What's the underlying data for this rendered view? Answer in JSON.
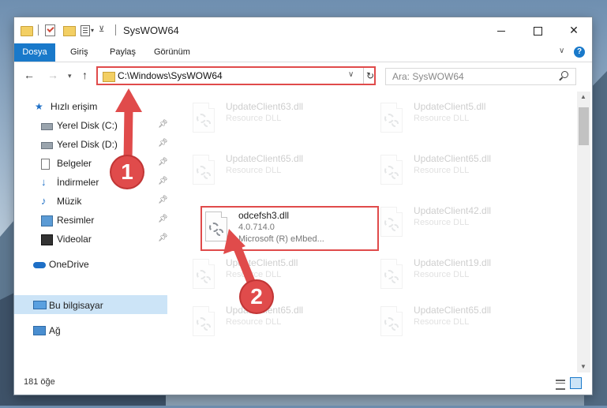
{
  "window": {
    "title": "SysWOW64",
    "controls": {
      "minimize": "",
      "maximize": "",
      "close": "✕"
    }
  },
  "ribbon": {
    "tabs": [
      "Dosya",
      "Giriş",
      "Paylaş",
      "Görünüm"
    ],
    "help": "?"
  },
  "address": {
    "path": "C:\\Windows\\SysWOW64",
    "refresh_icon": "↻",
    "search_placeholder": "Ara: SysWOW64"
  },
  "sidebar": {
    "quick_access": "Hızlı erişim",
    "items": [
      {
        "label": "Yerel Disk (C:)",
        "icon": "disk-icon",
        "pinned": true
      },
      {
        "label": "Yerel Disk (D:)",
        "icon": "disk-icon",
        "pinned": true
      },
      {
        "label": "Belgeler",
        "icon": "documents-icon",
        "pinned": true
      },
      {
        "label": "İndirmeler",
        "icon": "downloads-icon",
        "pinned": true
      },
      {
        "label": "Müzik",
        "icon": "music-icon",
        "pinned": true
      },
      {
        "label": "Resimler",
        "icon": "pictures-icon",
        "pinned": true
      },
      {
        "label": "Videolar",
        "icon": "videos-icon",
        "pinned": true
      }
    ],
    "onedrive": "OneDrive",
    "this_pc": "Bu bilgisayar",
    "network": "Ağ"
  },
  "files": {
    "left": [
      {
        "name": "UpdateClient63.dll",
        "desc": "Resource DLL",
        "faded": true
      },
      {
        "name": "UpdateClient65.dll",
        "desc": "Resource DLL",
        "faded": true
      },
      {
        "name": "odcefsh3.dll",
        "version": "4.0.714.0",
        "desc": "Microsoft (R) eMbed...",
        "faded": false
      },
      {
        "name": "UpdateClient5.dll",
        "desc": "Resource DLL",
        "faded": true
      },
      {
        "name": "UpdateClient65.dll",
        "desc": "Resource DLL",
        "faded": true
      }
    ],
    "right": [
      {
        "name": "UpdateClient5.dll",
        "desc": "Resource DLL",
        "faded": true
      },
      {
        "name": "UpdateClient65.dll",
        "desc": "Resource DLL",
        "faded": true
      },
      {
        "name": "UpdateClient42.dll",
        "desc": "Resource DLL",
        "faded": true
      },
      {
        "name": "UpdateClient19.dll",
        "desc": "Resource DLL",
        "faded": true
      },
      {
        "name": "UpdateClient65.dll",
        "desc": "Resource DLL",
        "faded": true
      }
    ]
  },
  "status": {
    "item_count": "181 öğe"
  },
  "annotations": {
    "marker1": "1",
    "marker2": "2",
    "color": "#e04b4b"
  }
}
